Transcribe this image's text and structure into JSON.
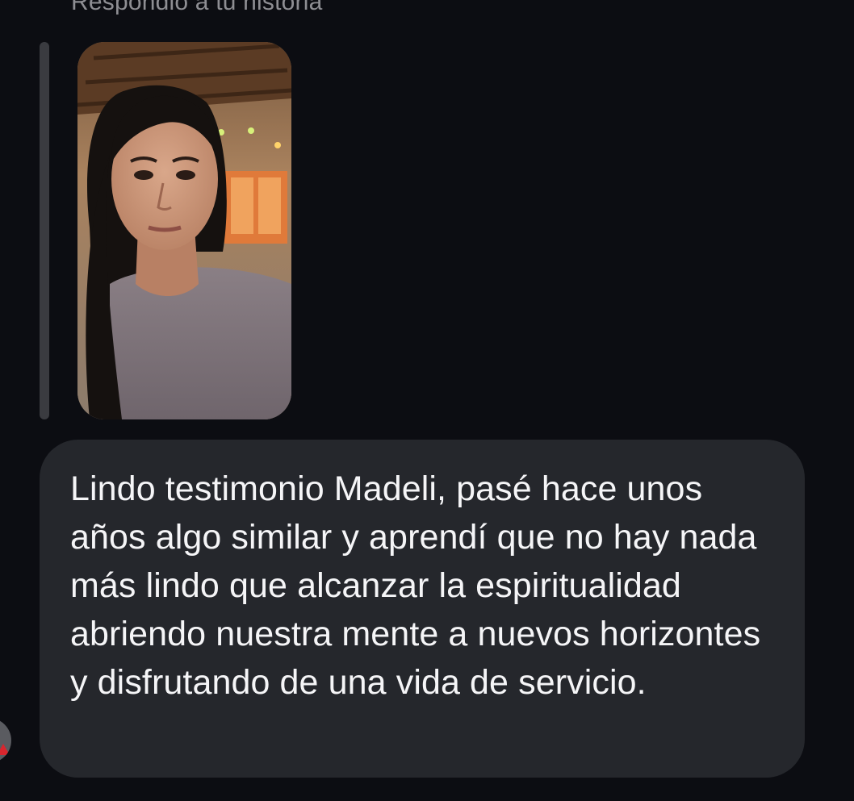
{
  "conversation": {
    "reply_header": "Respondió a tu historia",
    "story": {
      "kind": "story-reply-thumbnail",
      "alt": "story photo"
    },
    "message": {
      "text": "Lindo testimonio Madeli, pasé hace unos años algo similar y aprendí que no hay nada más lindo que alcanzar la espiritualidad abriendo nuestra mente a nuevos horizontes y disfrutando de una vida de servicio."
    },
    "sender": {
      "avatar_icon": "user-avatar"
    }
  },
  "colors": {
    "background": "#0c0d12",
    "bubble": "#25272c",
    "header_text": "#8e8e93",
    "message_text": "#f5f5f7",
    "quote_bar": "#3a3b40"
  }
}
